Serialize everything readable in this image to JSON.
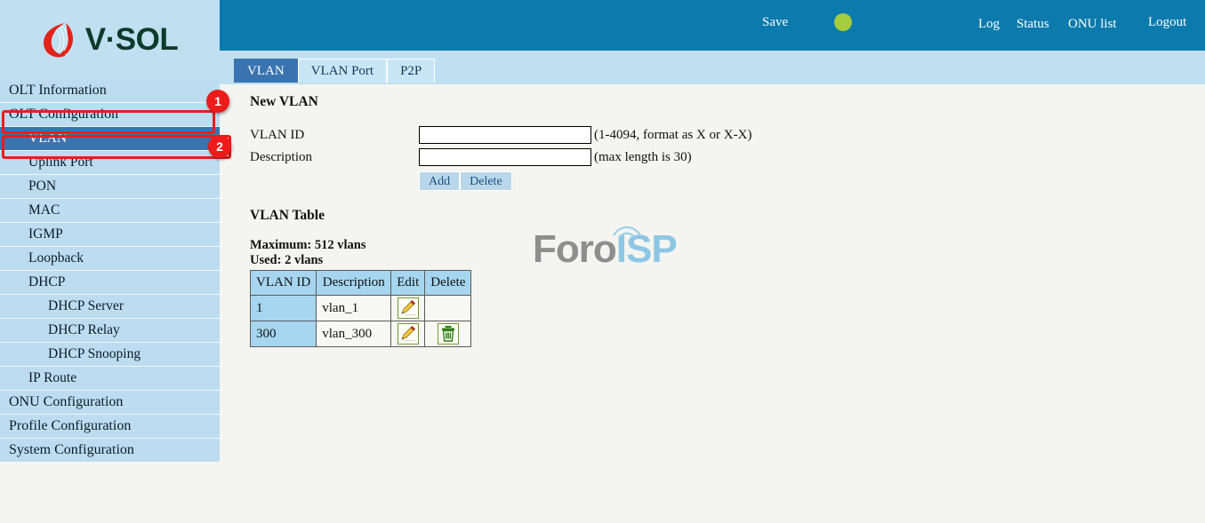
{
  "brand": {
    "name": "V·SOL",
    "logo_icon": "vsol-flame-logo"
  },
  "header": {
    "save_label": "Save",
    "indicator_color": "#a5cc3c",
    "log_label": "Log",
    "status_label": "Status",
    "onu_list_label": "ONU list",
    "logout_label": "Logout"
  },
  "tabs": [
    {
      "label": "VLAN",
      "active": true
    },
    {
      "label": "VLAN Port",
      "active": false
    },
    {
      "label": "P2P",
      "active": false
    }
  ],
  "sidebar": {
    "items": [
      {
        "label": "OLT Information",
        "level": 0,
        "active": false
      },
      {
        "label": "OLT Configuration",
        "level": 0,
        "active": false
      },
      {
        "label": "VLAN",
        "level": 1,
        "active": true
      },
      {
        "label": "Uplink Port",
        "level": 1,
        "active": false
      },
      {
        "label": "PON",
        "level": 1,
        "active": false
      },
      {
        "label": "MAC",
        "level": 1,
        "active": false
      },
      {
        "label": "IGMP",
        "level": 1,
        "active": false
      },
      {
        "label": "Loopback",
        "level": 1,
        "active": false
      },
      {
        "label": "DHCP",
        "level": 1,
        "active": false
      },
      {
        "label": "DHCP Server",
        "level": 2,
        "active": false
      },
      {
        "label": "DHCP Relay",
        "level": 2,
        "active": false
      },
      {
        "label": "DHCP Snooping",
        "level": 2,
        "active": false
      },
      {
        "label": "IP Route",
        "level": 1,
        "active": false
      },
      {
        "label": "ONU Configuration",
        "level": 0,
        "active": false
      },
      {
        "label": "Profile Configuration",
        "level": 0,
        "active": false
      },
      {
        "label": "System Configuration",
        "level": 0,
        "active": false
      }
    ]
  },
  "annotations": [
    {
      "number": "1",
      "target": "OLT Configuration",
      "color": "#ee1b1b"
    },
    {
      "number": "2",
      "target": "VLAN",
      "color": "#ee1b1b"
    }
  ],
  "main": {
    "new_vlan_title": "New VLAN",
    "form": {
      "vlan_id_label": "VLAN ID",
      "vlan_id_value": "",
      "vlan_id_hint": "(1-4094, format as X or X-X)",
      "description_label": "Description",
      "description_value": "",
      "description_hint": "(max length is 30)",
      "add_label": "Add",
      "delete_label": "Delete"
    },
    "table_title": "VLAN Table",
    "maximum_text": "Maximum: 512 vlans",
    "used_text": "Used: 2 vlans",
    "table": {
      "headers": [
        "VLAN ID",
        "Description",
        "Edit",
        "Delete"
      ],
      "rows": [
        {
          "vlan_id": "1",
          "description": "vlan_1",
          "edit_icon": "pencil-edit-icon",
          "delete_icon": ""
        },
        {
          "vlan_id": "300",
          "description": "vlan_300",
          "edit_icon": "pencil-edit-icon",
          "delete_icon": "trash-delete-icon"
        }
      ]
    }
  },
  "watermark": {
    "text_gray": "Foro",
    "text_blue": "ISP"
  }
}
